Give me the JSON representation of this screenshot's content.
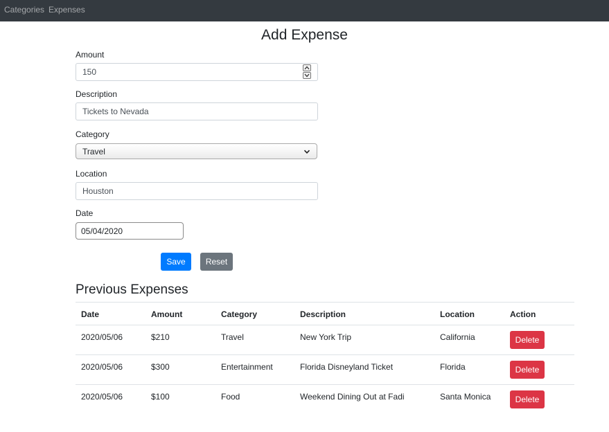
{
  "nav": {
    "items": [
      {
        "label": "Categories"
      },
      {
        "label": "Expenses"
      }
    ]
  },
  "page": {
    "title": "Add Expense"
  },
  "form": {
    "amount": {
      "label": "Amount",
      "value": "150"
    },
    "description": {
      "label": "Description",
      "value": "Tickets to Nevada"
    },
    "category": {
      "label": "Category",
      "value": "Travel"
    },
    "location": {
      "label": "Location",
      "value": "Houston"
    },
    "date": {
      "label": "Date",
      "value": "05/04/2020"
    },
    "save_label": "Save",
    "reset_label": "Reset"
  },
  "previous": {
    "title": "Previous Expenses",
    "columns": [
      "Date",
      "Amount",
      "Category",
      "Description",
      "Location",
      "Action"
    ],
    "rows": [
      {
        "date": "2020/05/06",
        "amount": "$210",
        "category": "Travel",
        "description": "New York Trip",
        "location": "California",
        "action": "Delete"
      },
      {
        "date": "2020/05/06",
        "amount": "$300",
        "category": "Entertainment",
        "description": "Florida Disneyland Ticket",
        "location": "Florida",
        "action": "Delete"
      },
      {
        "date": "2020/05/06",
        "amount": "$100",
        "category": "Food",
        "description": "Weekend Dining Out at Fadi",
        "location": "Santa Monica",
        "action": "Delete"
      }
    ]
  },
  "icons": {
    "amount_spin_up": "chevron-up-icon",
    "amount_spin_down": "chevron-down-icon",
    "category_select": "chevron-down-icon"
  },
  "colors": {
    "navbar": "#343a40",
    "primary": "#007bff",
    "secondary": "#6c757d",
    "danger": "#dc3545"
  }
}
